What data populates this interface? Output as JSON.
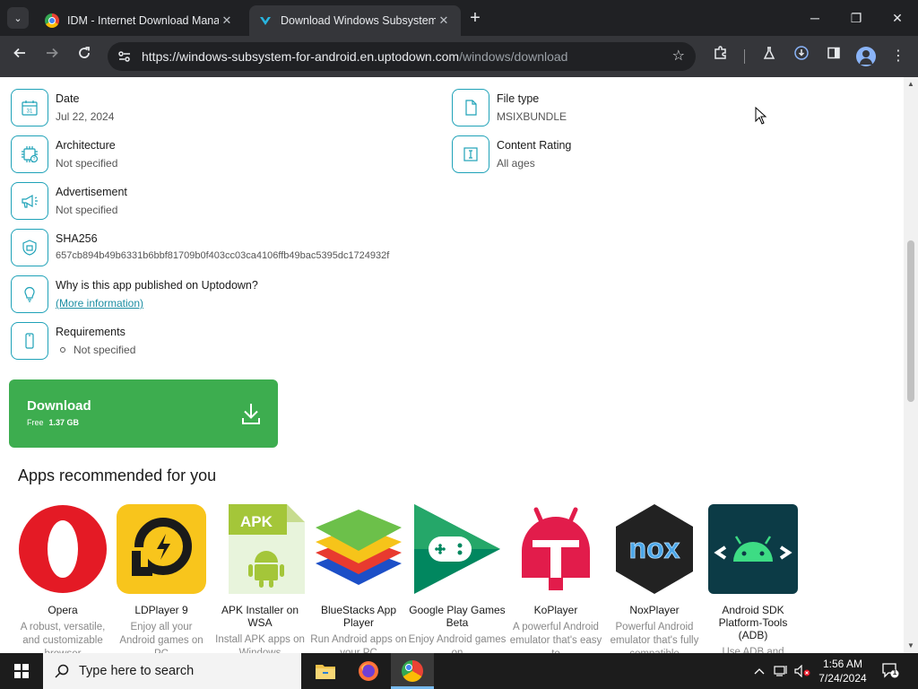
{
  "browser": {
    "tabs": [
      {
        "title": "IDM - Internet Download Manager",
        "active": false
      },
      {
        "title": "Download Windows Subsystem for Android",
        "active": true
      }
    ],
    "url_host": "https://windows-subsystem-for-android.en.uptodown.com",
    "url_path": "/windows/download",
    "window_controls": {
      "minimize": "─",
      "restore": "❐",
      "close": "✕"
    }
  },
  "details": {
    "left": [
      {
        "label": "Date",
        "value": "Jul 22, 2024",
        "icon": "calendar-icon"
      },
      {
        "label": "Architecture",
        "value": "Not specified",
        "icon": "chip-icon"
      },
      {
        "label": "Advertisement",
        "value": "Not specified",
        "icon": "megaphone-icon"
      },
      {
        "label": "SHA256",
        "value": "657cb894b49b6331b6bbf81709b0f403cc03ca4106ffb49bac5395dc1724932f",
        "icon": "shield-icon"
      },
      {
        "label": "Why is this app published on Uptodown?",
        "value": "(More information)",
        "icon": "lightbulb-icon"
      },
      {
        "label": "Requirements",
        "value": "Not specified",
        "icon": "phone-icon"
      }
    ],
    "right": [
      {
        "label": "File type",
        "value": "MSIXBUNDLE",
        "icon": "file-icon"
      },
      {
        "label": "Content Rating",
        "value": "All ages",
        "icon": "rating-icon"
      }
    ]
  },
  "download": {
    "label": "Download",
    "price": "Free",
    "size": "1.37 GB"
  },
  "recommended": {
    "title": "Apps recommended for you",
    "apps": [
      {
        "name": "Opera",
        "desc": "A robust, versatile, and customizable browser"
      },
      {
        "name": "LDPlayer 9",
        "desc": "Enjoy all your Android games on PC"
      },
      {
        "name": "APK Installer on WSA",
        "desc": "Install APK apps on Windows"
      },
      {
        "name": "BlueStacks App Player",
        "desc": "Run Android apps on your PC"
      },
      {
        "name": "Google Play Games Beta",
        "desc": "Enjoy Android games on"
      },
      {
        "name": "KoPlayer",
        "desc": "A powerful Android emulator that's easy to"
      },
      {
        "name": "NoxPlayer",
        "desc": "Powerful Android emulator that's fully compatible"
      },
      {
        "name": "Android SDK Platform-Tools (ADB)",
        "desc": "Use ADB and"
      }
    ],
    "apk_badge": "APK",
    "nox_logo": "nox"
  },
  "taskbar": {
    "search_placeholder": "Type here to search",
    "time": "1:56 AM",
    "date": "7/24/2024",
    "notification_count": "1"
  },
  "colors": {
    "accent_teal": "#1fa2b8",
    "download_green": "#3dad4f",
    "chrome_dark": "#202124",
    "chrome_toolbar": "#35363a"
  }
}
